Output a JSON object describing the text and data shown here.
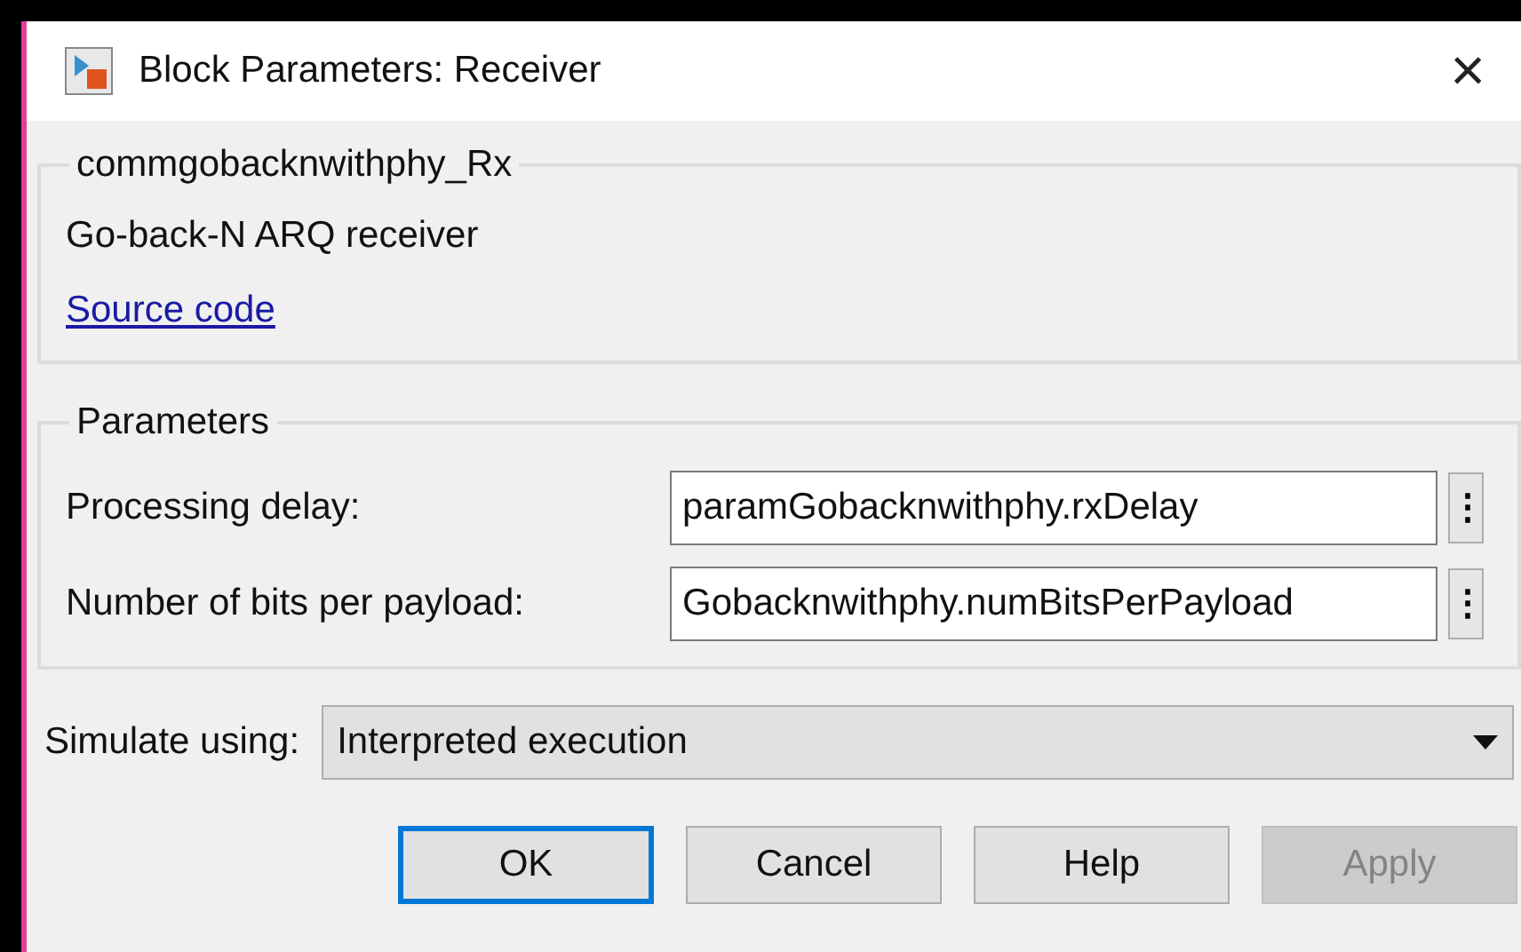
{
  "window": {
    "title": "Block Parameters: Receiver",
    "close": "×"
  },
  "description_group": {
    "legend": "commgobacknwithphy_Rx",
    "text": "Go-back-N ARQ receiver",
    "link": "Source code"
  },
  "parameters_group": {
    "legend": "Parameters",
    "fields": [
      {
        "label": "Processing delay:",
        "value": "paramGobacknwithphy.rxDelay",
        "menu": "⋮"
      },
      {
        "label": "Number of bits per payload:",
        "value": "Gobacknwithphy.numBitsPerPayload",
        "menu": "⋮"
      }
    ]
  },
  "simulate": {
    "label": "Simulate using:",
    "value": "Interpreted execution"
  },
  "buttons": [
    {
      "label": "OK",
      "focused": true,
      "disabled": false
    },
    {
      "label": "Cancel",
      "focused": false,
      "disabled": false
    },
    {
      "label": "Help",
      "focused": false,
      "disabled": false
    },
    {
      "label": "Apply",
      "focused": false,
      "disabled": true
    }
  ]
}
